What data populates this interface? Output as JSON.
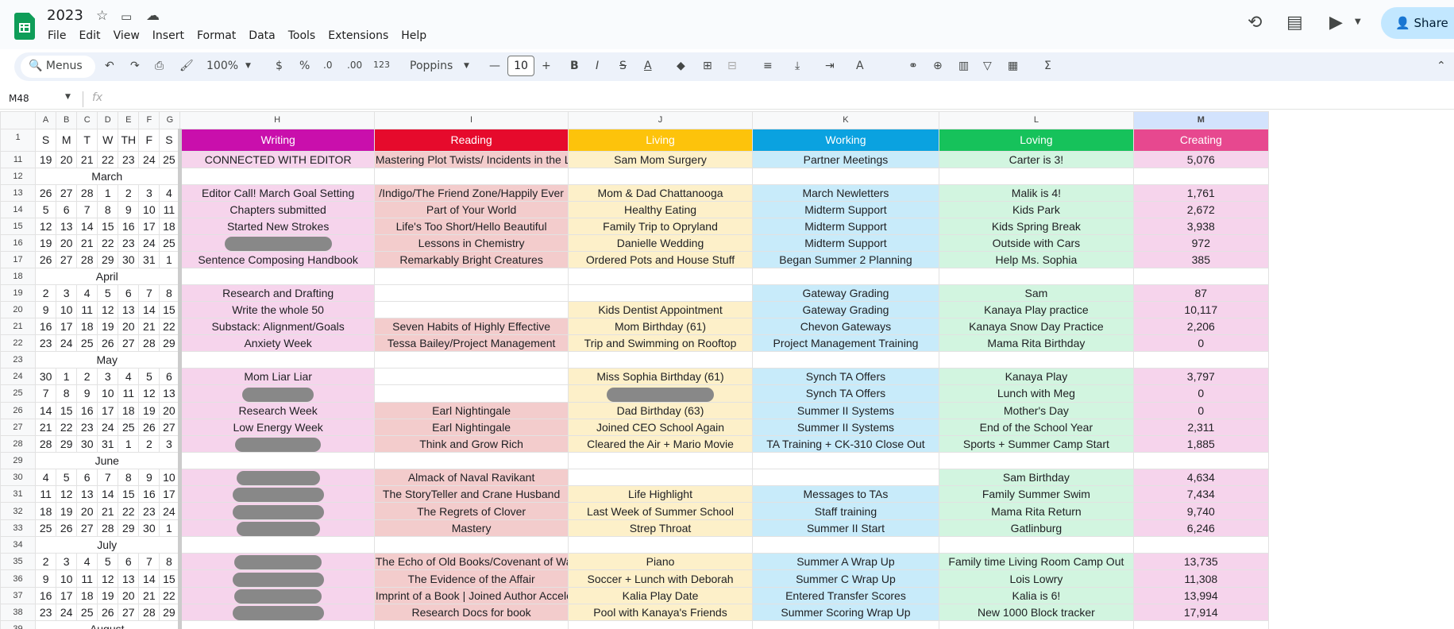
{
  "app": {
    "title": "2023",
    "menus": [
      "File",
      "Edit",
      "View",
      "Insert",
      "Format",
      "Data",
      "Tools",
      "Extensions",
      "Help"
    ],
    "share_label": "Share"
  },
  "toolbar": {
    "search_label": "Menus",
    "zoom": "100%",
    "currency": "$",
    "percent": "%",
    "dec_dec": ".0",
    "inc_dec": ".00",
    "format_123": "123",
    "font": "Poppins",
    "font_size": "10"
  },
  "formula": {
    "cell_ref": "M48",
    "fx": "fx"
  },
  "columns": [
    "A",
    "B",
    "C",
    "D",
    "E",
    "F",
    "G",
    "H",
    "I",
    "J",
    "K",
    "L",
    "M"
  ],
  "day_headers": [
    "S",
    "M",
    "T",
    "W",
    "TH",
    "F",
    "S"
  ],
  "categories": {
    "H": "Writing",
    "I": "Reading",
    "J": "Living",
    "K": "Working",
    "L": "Loving",
    "M": "Creating"
  },
  "category_colors": {
    "H": "#c90fac",
    "I": "#e60a2c",
    "J": "#fdc30b",
    "K": "#0aa2e0",
    "L": "#16c25b",
    "M": "#e7488f"
  },
  "rows": [
    {
      "n": "11",
      "type": "week",
      "days": [
        "19",
        "20",
        "21",
        "22",
        "23",
        "24",
        "25"
      ],
      "H": "CONNECTED WITH EDITOR",
      "I": "Mastering Plot Twists/ Incidents in the L",
      "J": "Sam Mom Surgery",
      "K": "Partner Meetings",
      "L": "Carter is 3!",
      "M": "5,076"
    },
    {
      "n": "12",
      "type": "month",
      "label": "March"
    },
    {
      "n": "13",
      "type": "week",
      "days": [
        "26",
        "27",
        "28",
        "1",
        "2",
        "3",
        "4"
      ],
      "H": "Editor Call! March Goal Setting",
      "I": "/Indigo/The Friend Zone/Happily Ever",
      "J": "Mom & Dad Chattanooga",
      "K": "March Newletters",
      "L": "Malik is 4!",
      "M": "1,761"
    },
    {
      "n": "14",
      "type": "week",
      "days": [
        "5",
        "6",
        "7",
        "8",
        "9",
        "10",
        "11"
      ],
      "H": "Chapters submitted",
      "I": "Part of Your World",
      "J": "Healthy Eating",
      "K": "Midterm Support",
      "L": "Kids Park",
      "M": "2,672"
    },
    {
      "n": "15",
      "type": "week",
      "days": [
        "12",
        "13",
        "14",
        "15",
        "16",
        "17",
        "18"
      ],
      "H": "Started New Strokes",
      "I": "Life's Too Short/Hello Beautiful",
      "J": "Family Trip to Opryland",
      "K": "Midterm Support",
      "L": "Kids Spring Break",
      "M": "3,938"
    },
    {
      "n": "16",
      "type": "week",
      "days": [
        "19",
        "20",
        "21",
        "22",
        "23",
        "24",
        "25"
      ],
      "H": "",
      "Hr": 135,
      "I": "Lessons in Chemistry",
      "J": "Danielle Wedding",
      "K": "Midterm Support",
      "L": "Outside with Cars",
      "M": "972"
    },
    {
      "n": "17",
      "type": "week",
      "days": [
        "26",
        "27",
        "28",
        "29",
        "30",
        "31",
        "1"
      ],
      "H": "Sentence Composing Handbook",
      "I": "Remarkably Bright Creatures",
      "J": "Ordered Pots and House Stuff",
      "K": "Began Summer 2 Planning",
      "L": "Help Ms. Sophia",
      "M": "385"
    },
    {
      "n": "18",
      "type": "month",
      "label": "April"
    },
    {
      "n": "19",
      "type": "week",
      "days": [
        "2",
        "3",
        "4",
        "5",
        "6",
        "7",
        "8"
      ],
      "H": "Research and Drafting",
      "I": "",
      "J": "",
      "K": "Gateway Grading",
      "L": "Sam",
      "M": "87"
    },
    {
      "n": "20",
      "type": "week",
      "days": [
        "9",
        "10",
        "11",
        "12",
        "13",
        "14",
        "15"
      ],
      "H": "Write the whole 50",
      "I": "",
      "J": "Kids Dentist Appointment",
      "K": "Gateway Grading",
      "L": "Kanaya Play practice",
      "M": "10,117"
    },
    {
      "n": "21",
      "type": "week",
      "days": [
        "16",
        "17",
        "18",
        "19",
        "20",
        "21",
        "22"
      ],
      "H": "Substack: Alignment/Goals",
      "I": "Seven Habits of Highly Effective",
      "J": "Mom Birthday (61)",
      "K": "Chevon Gateways",
      "L": "Kanaya Snow Day Practice",
      "M": "2,206"
    },
    {
      "n": "22",
      "type": "week",
      "days": [
        "23",
        "24",
        "25",
        "26",
        "27",
        "28",
        "29"
      ],
      "H": "Anxiety Week",
      "I": "Tessa Bailey/Project Management",
      "J": "Trip and Swimming on Rooftop",
      "K": "Project Management Training",
      "L": "Mama Rita Birthday",
      "M": "0"
    },
    {
      "n": "23",
      "type": "month",
      "label": "May"
    },
    {
      "n": "24",
      "type": "week",
      "days": [
        "30",
        "1",
        "2",
        "3",
        "4",
        "5",
        "6"
      ],
      "H": "Mom Liar Liar",
      "I": "",
      "J": "Miss Sophia Birthday (61)",
      "K": "Synch TA Offers",
      "L": "Kanaya Play",
      "M": "3,797"
    },
    {
      "n": "25",
      "type": "week",
      "days": [
        "7",
        "8",
        "9",
        "10",
        "11",
        "12",
        "13"
      ],
      "H": "",
      "Hr": 90,
      "I": "",
      "J": "",
      "Jr": 135,
      "K": "Synch TA Offers",
      "L": "Lunch with Meg",
      "M": "0"
    },
    {
      "n": "26",
      "type": "week",
      "days": [
        "14",
        "15",
        "16",
        "17",
        "18",
        "19",
        "20"
      ],
      "H": "Research Week",
      "I": "Earl Nightingale",
      "J": "Dad Birthday (63)",
      "K": "Summer II Systems",
      "L": "Mother's Day",
      "M": "0"
    },
    {
      "n": "27",
      "type": "week",
      "days": [
        "21",
        "22",
        "23",
        "24",
        "25",
        "26",
        "27"
      ],
      "H": "Low Energy Week",
      "I": "Earl Nightingale",
      "J": "Joined CEO School Again",
      "K": "Summer II Systems",
      "L": "End of the School Year",
      "M": "2,311"
    },
    {
      "n": "28",
      "type": "week",
      "days": [
        "28",
        "29",
        "30",
        "31",
        "1",
        "2",
        "3"
      ],
      "H": "",
      "Hr": 108,
      "I": "Think and Grow Rich",
      "J": "Cleared the Air + Mario Movie",
      "K": "TA Training + CK-310 Close Out",
      "L": "Sports + Summer Camp Start",
      "M": "1,885"
    },
    {
      "n": "29",
      "type": "month",
      "label": "June"
    },
    {
      "n": "30",
      "type": "week",
      "days": [
        "4",
        "5",
        "6",
        "7",
        "8",
        "9",
        "10"
      ],
      "H": "",
      "Hr": 105,
      "I": "Almack of Naval Ravikant",
      "J": "",
      "K": "",
      "L": "Sam Birthday",
      "M": "4,634"
    },
    {
      "n": "31",
      "type": "week",
      "days": [
        "11",
        "12",
        "13",
        "14",
        "15",
        "16",
        "17"
      ],
      "H": "",
      "Hr": 115,
      "I": "The StoryTeller and Crane Husband",
      "J": "Life Highlight",
      "K": "Messages to TAs",
      "L": "Family Summer Swim",
      "M": "7,434"
    },
    {
      "n": "32",
      "type": "week",
      "days": [
        "18",
        "19",
        "20",
        "21",
        "22",
        "23",
        "24"
      ],
      "H": "",
      "Hr": 115,
      "I": "The Regrets of Clover",
      "J": "Last Week of Summer School",
      "K": "Staff training",
      "L": "Mama Rita Return",
      "M": "9,740"
    },
    {
      "n": "33",
      "type": "week",
      "days": [
        "25",
        "26",
        "27",
        "28",
        "29",
        "30",
        "1"
      ],
      "H": "",
      "Hr": 105,
      "I": "Mastery",
      "J": "Strep Throat",
      "K": "Summer II Start",
      "L": "Gatlinburg",
      "M": "6,246"
    },
    {
      "n": "34",
      "type": "month",
      "label": "July"
    },
    {
      "n": "35",
      "type": "week",
      "days": [
        "2",
        "3",
        "4",
        "5",
        "6",
        "7",
        "8"
      ],
      "H": "",
      "Hr": 110,
      "I": "The Echo of Old Books/Covenant of Wat",
      "J": "Piano",
      "K": "Summer A Wrap Up",
      "L": "Family time Living Room Camp Out",
      "M": "13,735"
    },
    {
      "n": "36",
      "type": "week",
      "days": [
        "9",
        "10",
        "11",
        "12",
        "13",
        "14",
        "15"
      ],
      "H": "",
      "Hr": 115,
      "I": "The Evidence of the Affair",
      "J": "Soccer + Lunch with Deborah",
      "K": "Summer C Wrap Up",
      "L": "Lois Lowry",
      "M": "11,308"
    },
    {
      "n": "37",
      "type": "week",
      "days": [
        "16",
        "17",
        "18",
        "19",
        "20",
        "21",
        "22"
      ],
      "H": "",
      "Hr": 110,
      "I": "Imprint of a Book | Joined Author Accele",
      "J": "Kalia Play Date",
      "K": "Entered Transfer Scores",
      "L": "Kalia is 6!",
      "M": "13,994"
    },
    {
      "n": "38",
      "type": "week",
      "days": [
        "23",
        "24",
        "25",
        "26",
        "27",
        "28",
        "29"
      ],
      "H": "",
      "Hr": 115,
      "I": "Research Docs for book",
      "J": "Pool with Kanaya's Friends",
      "K": "Summer Scoring Wrap Up",
      "L": "New 1000 Block tracker",
      "M": "17,914"
    },
    {
      "n": "39",
      "type": "month",
      "label": "August"
    }
  ]
}
